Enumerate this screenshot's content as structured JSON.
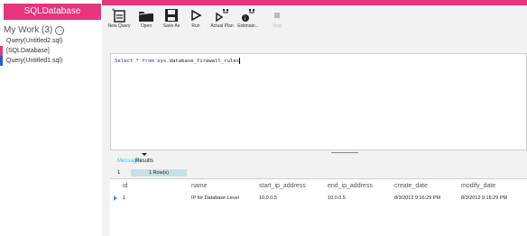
{
  "app": {
    "title": "SQLDatabase",
    "accent": "#e8347c"
  },
  "sidebar": {
    "work_label": "My Work (3)",
    "work_icon": "arrow-right-circle-icon",
    "items": [
      {
        "label": "Query(Untitled2.sql)",
        "color": "#ffffff"
      },
      {
        "label": "[SQLDatabase]",
        "color": "#e8347c"
      },
      {
        "label": "Query(Untitled1.sql)",
        "color": "#1f5fc4"
      }
    ]
  },
  "toolbar": {
    "buttons": [
      {
        "label": "New Query",
        "icon": "new-query-icon"
      },
      {
        "label": "Open",
        "icon": "folder-icon"
      },
      {
        "label": "Save As",
        "icon": "save-icon"
      },
      {
        "label": "Run",
        "icon": "run-icon"
      },
      {
        "label": "Actual Plan",
        "icon": "actual-plan-icon"
      },
      {
        "label": "Estimate...",
        "icon": "estimate-icon"
      },
      {
        "label": "Stop",
        "icon": "stop-icon"
      }
    ]
  },
  "editor": {
    "keyword_select": "Select",
    "star": " * ",
    "keyword_from": "from",
    "table": " sys.database_firewall_rules"
  },
  "results": {
    "tabs": {
      "messages": "Messages",
      "results": "Results"
    },
    "page": "1",
    "row_count": "1 Row(s)",
    "columns": [
      "id",
      "name",
      "start_ip_address",
      "end_ip_address",
      "create_date",
      "modify_date"
    ],
    "rows": [
      [
        "1",
        "IP for Database Level",
        "10.0.0.5",
        "10.0.0.5",
        "8/3/2012 9:16:29 PM",
        "8/3/2012 9:16:29 PM"
      ]
    ]
  }
}
